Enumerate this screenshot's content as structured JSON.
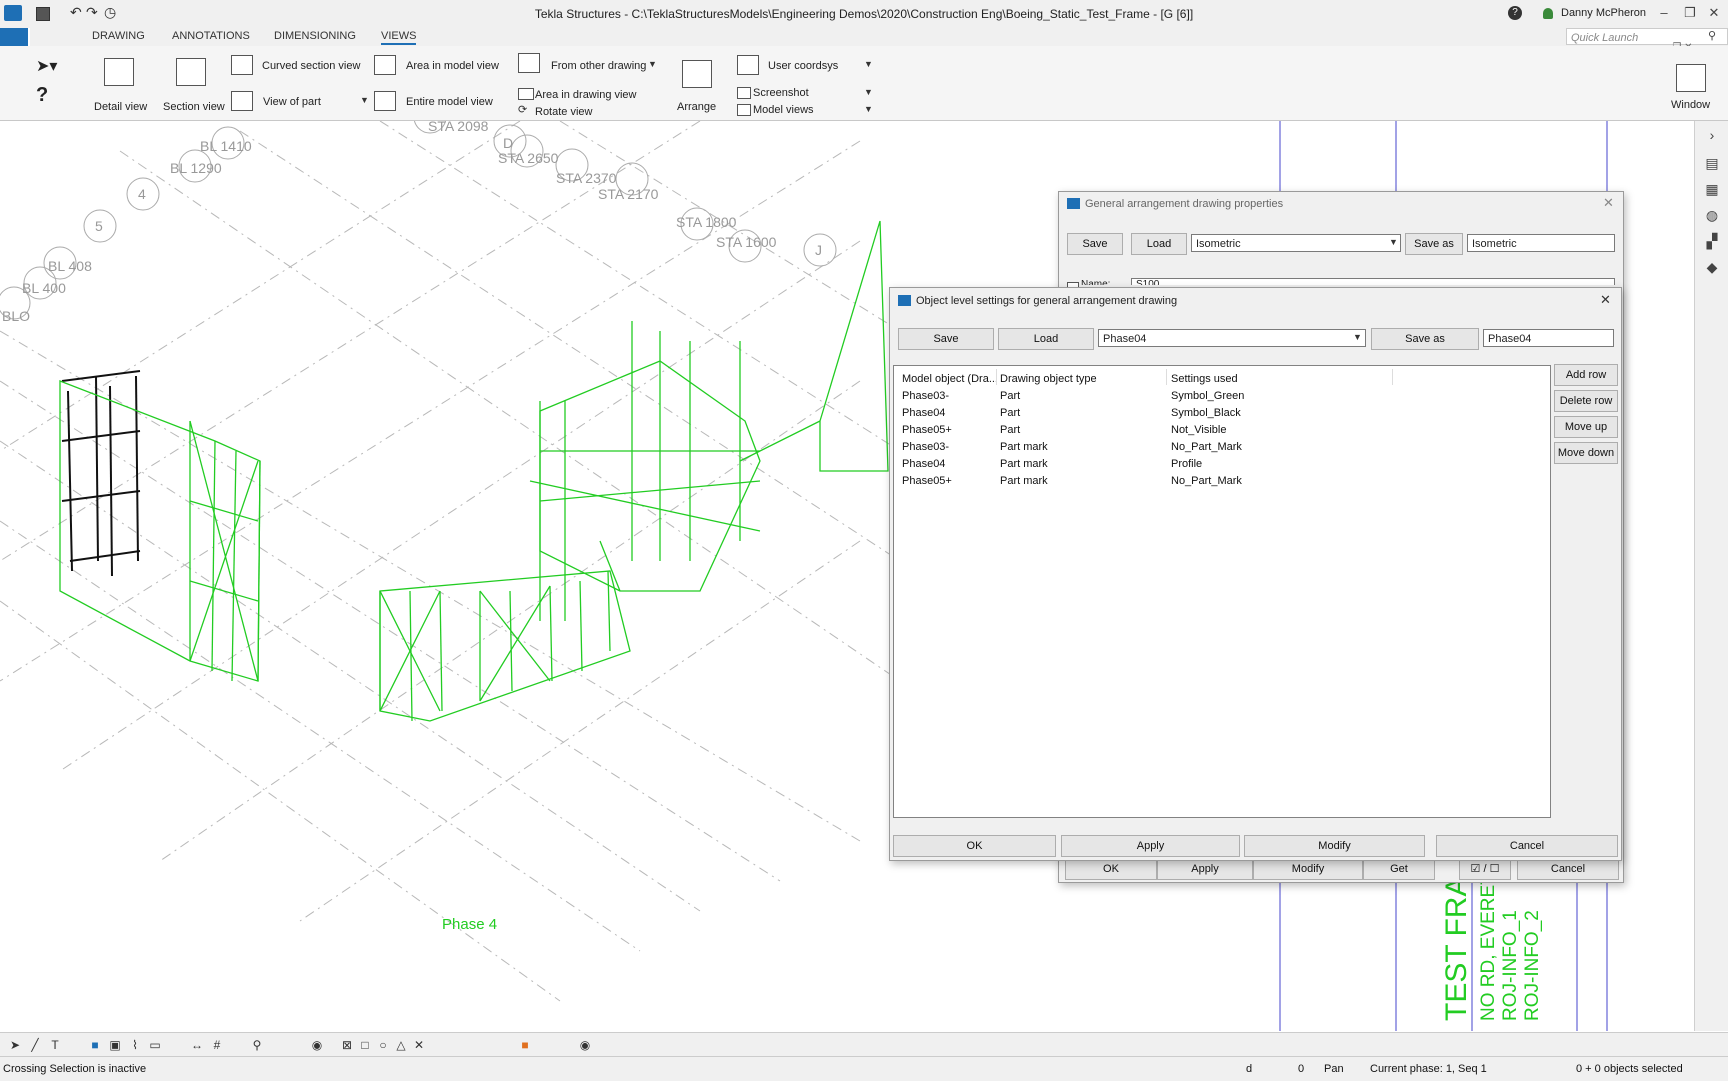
{
  "window": {
    "title": "Tekla Structures - C:\\TeklaStructuresModels\\Engineering Demos\\2020\\Construction Eng\\Boeing_Static_Test_Frame - [G  [6]]",
    "user": "Danny McPheron",
    "quick_launch_placeholder": "Quick Launch",
    "help": "?"
  },
  "ribbon": {
    "tabs": [
      "DRAWING",
      "ANNOTATIONS",
      "DIMENSIONING",
      "VIEWS"
    ],
    "active_tab": "VIEWS",
    "detail_view": "Detail view",
    "section_view": "Section view",
    "curved_section_view": "Curved section view",
    "view_of_part": "View of part",
    "area_in_model_view": "Area in model view",
    "entire_model_view": "Entire model view",
    "from_other_drawing": "From other drawing",
    "area_in_drawing_view": "Area in drawing view",
    "rotate_view": "Rotate view",
    "arrange": "Arrange",
    "user_coordsys": "User coordsys",
    "screenshot": "Screenshot",
    "model_views": "Model views",
    "window": "Window"
  },
  "canvas": {
    "labels": [
      "BL 1410",
      "BL 1290",
      "4",
      "5",
      "BL 408",
      "BL 400",
      "BLO",
      "STA 2098",
      "D",
      "STA 2650",
      "STA 2370",
      "STA 2170",
      "STA 1800",
      "STA 1600",
      "J"
    ],
    "phase_label": "Phase 4",
    "title_block": [
      "TEST FRA",
      "NO RD, EVERET",
      "ROJ-INFO_1",
      "ROJ-INFO_2"
    ],
    "colors": {
      "green": "#22cc22",
      "black": "#111111",
      "grid": "#b8b8b8"
    }
  },
  "ga_dialog": {
    "title": "General arrangement drawing properties",
    "save": "Save",
    "load": "Load",
    "preset": "Isometric",
    "save_as": "Save as",
    "save_as_value": "Isometric",
    "name_label": "Name:",
    "name_value": "S100",
    "ok": "OK",
    "apply": "Apply",
    "modify": "Modify",
    "get": "Get",
    "cancel": "Cancel"
  },
  "ols_dialog": {
    "title": "Object level settings for general arrangement drawing",
    "save": "Save",
    "load": "Load",
    "preset": "Phase04",
    "save_as": "Save as",
    "save_as_value": "Phase04",
    "columns": [
      "Model object (Dra...",
      "Drawing object type",
      "Settings used"
    ],
    "rows": [
      [
        "Phase03-",
        "Part",
        "Symbol_Green"
      ],
      [
        "Phase04",
        "Part",
        "Symbol_Black"
      ],
      [
        "Phase05+",
        "Part",
        "Not_Visible"
      ],
      [
        "Phase03-",
        "Part mark",
        "No_Part_Mark"
      ],
      [
        "Phase04",
        "Part mark",
        "Profile"
      ],
      [
        "Phase05+",
        "Part mark",
        "No_Part_Mark"
      ]
    ],
    "add_row": "Add row",
    "delete_row": "Delete row",
    "move_up": "Move up",
    "move_down": "Move down",
    "ok": "OK",
    "apply": "Apply",
    "modify": "Modify",
    "cancel": "Cancel"
  },
  "status": {
    "message": "Crossing Selection is inactive",
    "d": "d",
    "zero": "0",
    "pan": "Pan",
    "phase": "Current phase: 1, Seq 1",
    "selected": "0 + 0 objects selected"
  }
}
